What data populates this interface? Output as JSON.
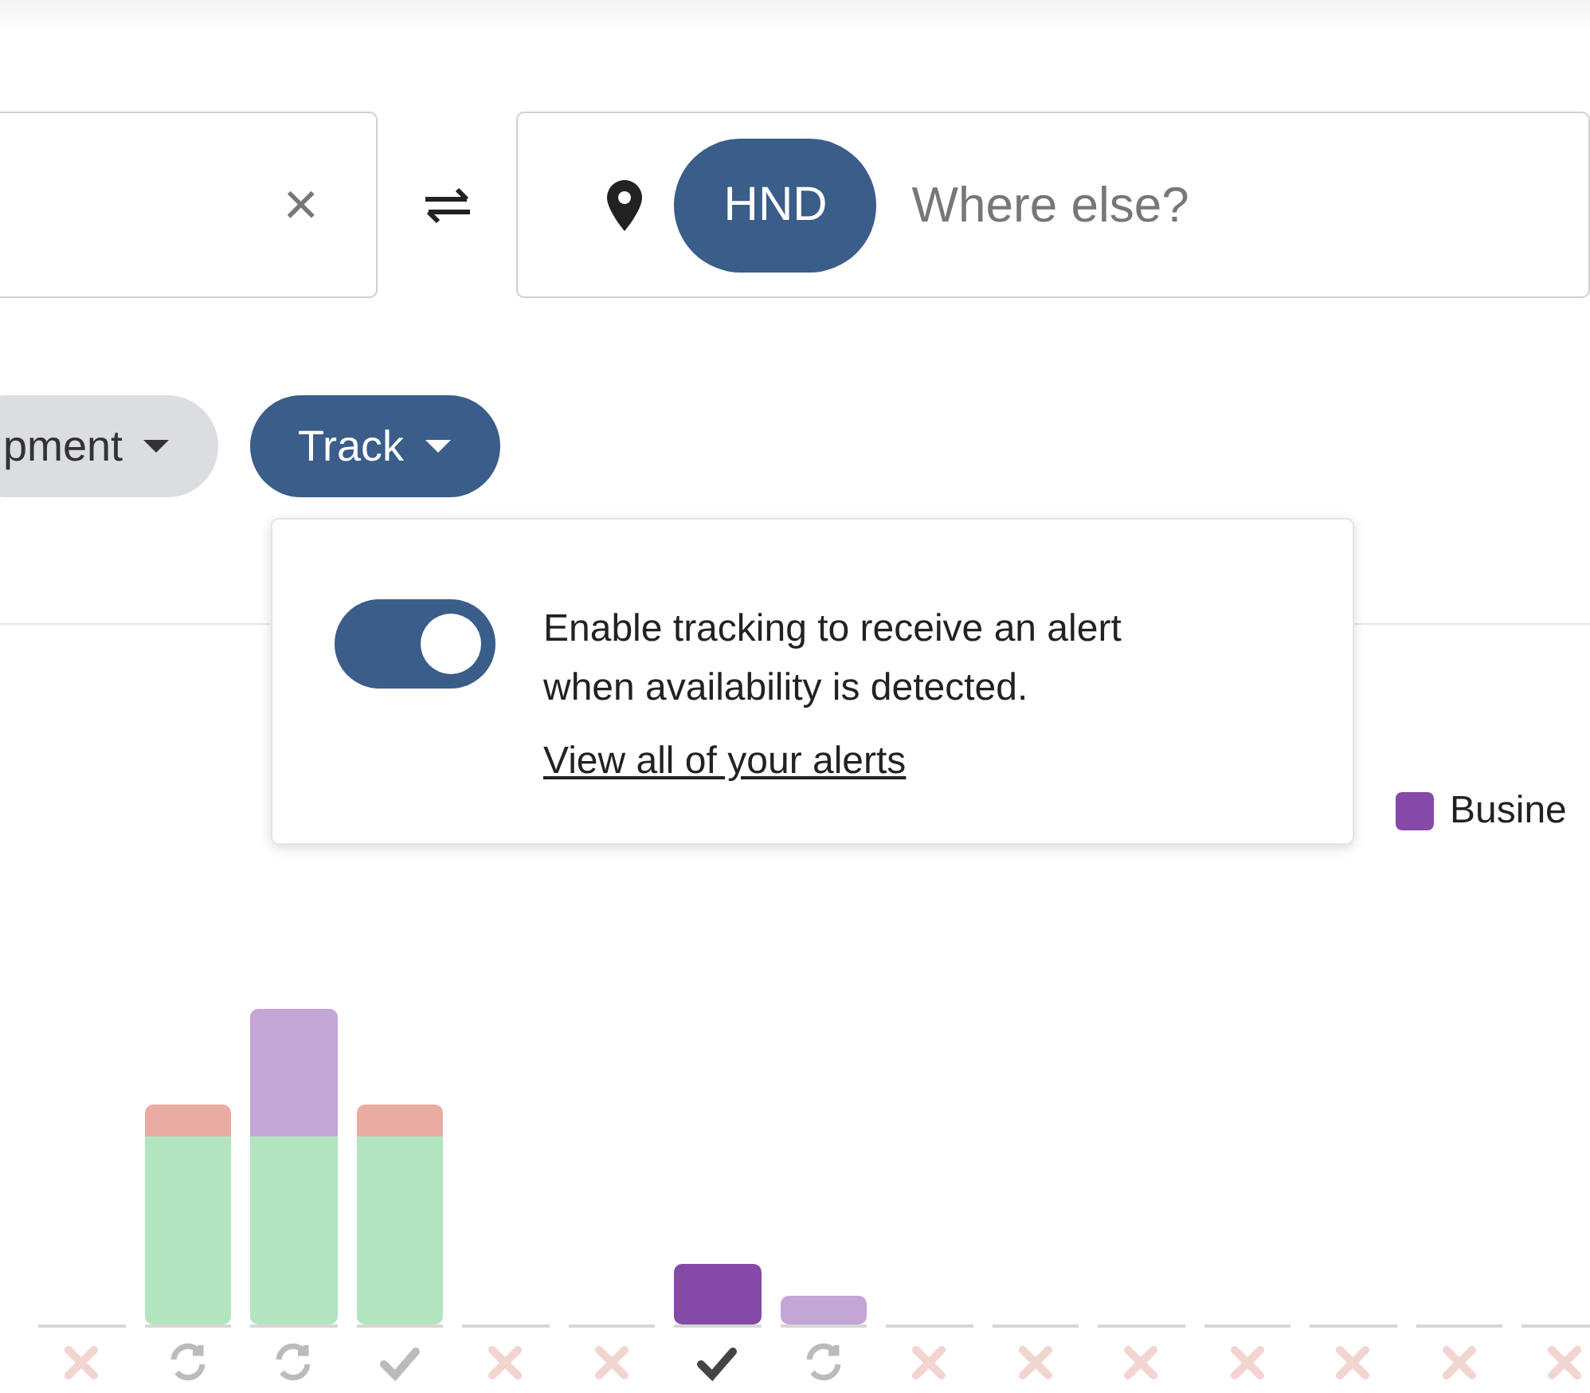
{
  "search": {
    "origin": {
      "clear_label": "×"
    },
    "destination": {
      "chip": "HND",
      "placeholder": "Where else?"
    }
  },
  "filters": [
    {
      "label": "pment",
      "active": false
    },
    {
      "label": "Track",
      "active": true
    }
  ],
  "popover": {
    "toggle_on": true,
    "text": "Enable tracking to receive an alert when availability is detected.",
    "link": "View all of your alerts"
  },
  "legend": [
    {
      "label": "Busine",
      "color": "#8549a7"
    }
  ],
  "days": [
    {
      "kind": "none",
      "selected": false
    },
    {
      "kind": "refresh",
      "selected": false
    },
    {
      "kind": "refresh",
      "selected": false
    },
    {
      "kind": "check",
      "selected": false
    },
    {
      "kind": "none",
      "selected": false
    },
    {
      "kind": "none",
      "selected": false
    },
    {
      "kind": "check",
      "selected": true
    },
    {
      "kind": "refresh",
      "selected": false
    },
    {
      "kind": "none",
      "selected": false
    },
    {
      "kind": "none",
      "selected": false
    },
    {
      "kind": "none",
      "selected": false
    },
    {
      "kind": "none",
      "selected": false
    },
    {
      "kind": "none",
      "selected": false
    },
    {
      "kind": "none",
      "selected": false
    },
    {
      "kind": "none",
      "selected": false
    }
  ]
}
